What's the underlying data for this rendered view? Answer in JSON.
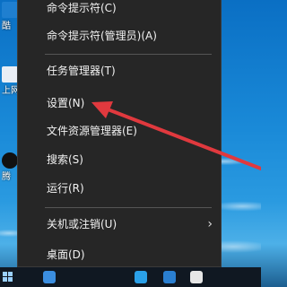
{
  "desktop": {
    "icons": [
      {
        "label": "酷"
      },
      {
        "label": "上网"
      },
      {
        "label": "腾"
      }
    ]
  },
  "menu": {
    "items": [
      {
        "label": "命令提示符(C)"
      },
      {
        "label": "命令提示符(管理员)(A)"
      },
      {
        "label": "任务管理器(T)"
      },
      {
        "label": "设置(N)"
      },
      {
        "label": "文件资源管理器(E)"
      },
      {
        "label": "搜索(S)"
      },
      {
        "label": "运行(R)"
      },
      {
        "label": "关机或注销(U)",
        "submenu_glyph": "›"
      },
      {
        "label": "桌面(D)"
      }
    ]
  },
  "colors": {
    "menu_bg": "#262626",
    "menu_text": "#f2f2f2",
    "separator": "#555555",
    "annotation_arrow": "#e0393e"
  }
}
